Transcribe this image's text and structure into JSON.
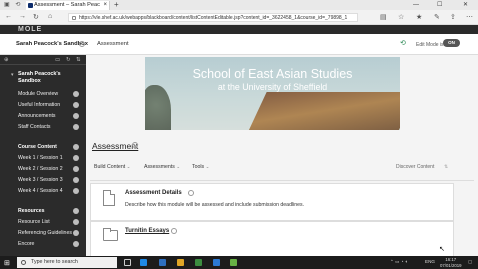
{
  "browser": {
    "tab_title": "Assessment – Sarah Peac",
    "new_tab": "+",
    "url": "https://vle.shef.ac.uk/webapps/blackboard/content/listContentEditable.jsp?content_id=_3622458_1&course_id=_79898_1",
    "back": "←",
    "forward": "→",
    "refresh": "↻",
    "home": "⌂",
    "minimize": "—",
    "maximize": "☐",
    "close": "✕"
  },
  "bb": {
    "logo_text": "MOLE"
  },
  "breadcrumb": {
    "course": "Sarah Peacock's Sandbox",
    "page": "Assessment",
    "edit_mode_label": "Edit Mode is:",
    "edit_mode_value": "ON"
  },
  "sidebar": {
    "course_title_line1": "Sarah Peacock's",
    "course_title_line2": "Sandbox",
    "items": [
      {
        "label": "Module Overview"
      },
      {
        "label": "Useful Information"
      },
      {
        "label": "Announcements"
      },
      {
        "label": "Staff Contacts"
      }
    ],
    "heading_content": "Course Content",
    "weeks": [
      {
        "label": "Week 1 / Session 1"
      },
      {
        "label": "Week 2 / Session 2"
      },
      {
        "label": "Week 3 / Session 3"
      },
      {
        "label": "Week 4 / Session 4"
      }
    ],
    "heading_resources": "Resources",
    "resources": [
      {
        "label": "Resource List"
      },
      {
        "label": "Referencing Guidelines"
      },
      {
        "label": "Encore"
      }
    ]
  },
  "main": {
    "banner_line1": "School of East Asian Studies",
    "banner_line2": "at the University of Sheffield",
    "page_title": "Assessment",
    "actions": {
      "build": "Build Content",
      "assessments": "Assessments",
      "tools": "Tools",
      "discover": "Discover Content"
    },
    "cards": [
      {
        "title": "Assessment Details",
        "description": "Describe how this module will be assessed and include submission deadlines."
      },
      {
        "title": "Turnitin Essays",
        "description": ""
      }
    ]
  },
  "taskbar": {
    "search_placeholder": "Type here to search",
    "language": "ENG",
    "time": "16:17",
    "date": "07/01/2019"
  }
}
